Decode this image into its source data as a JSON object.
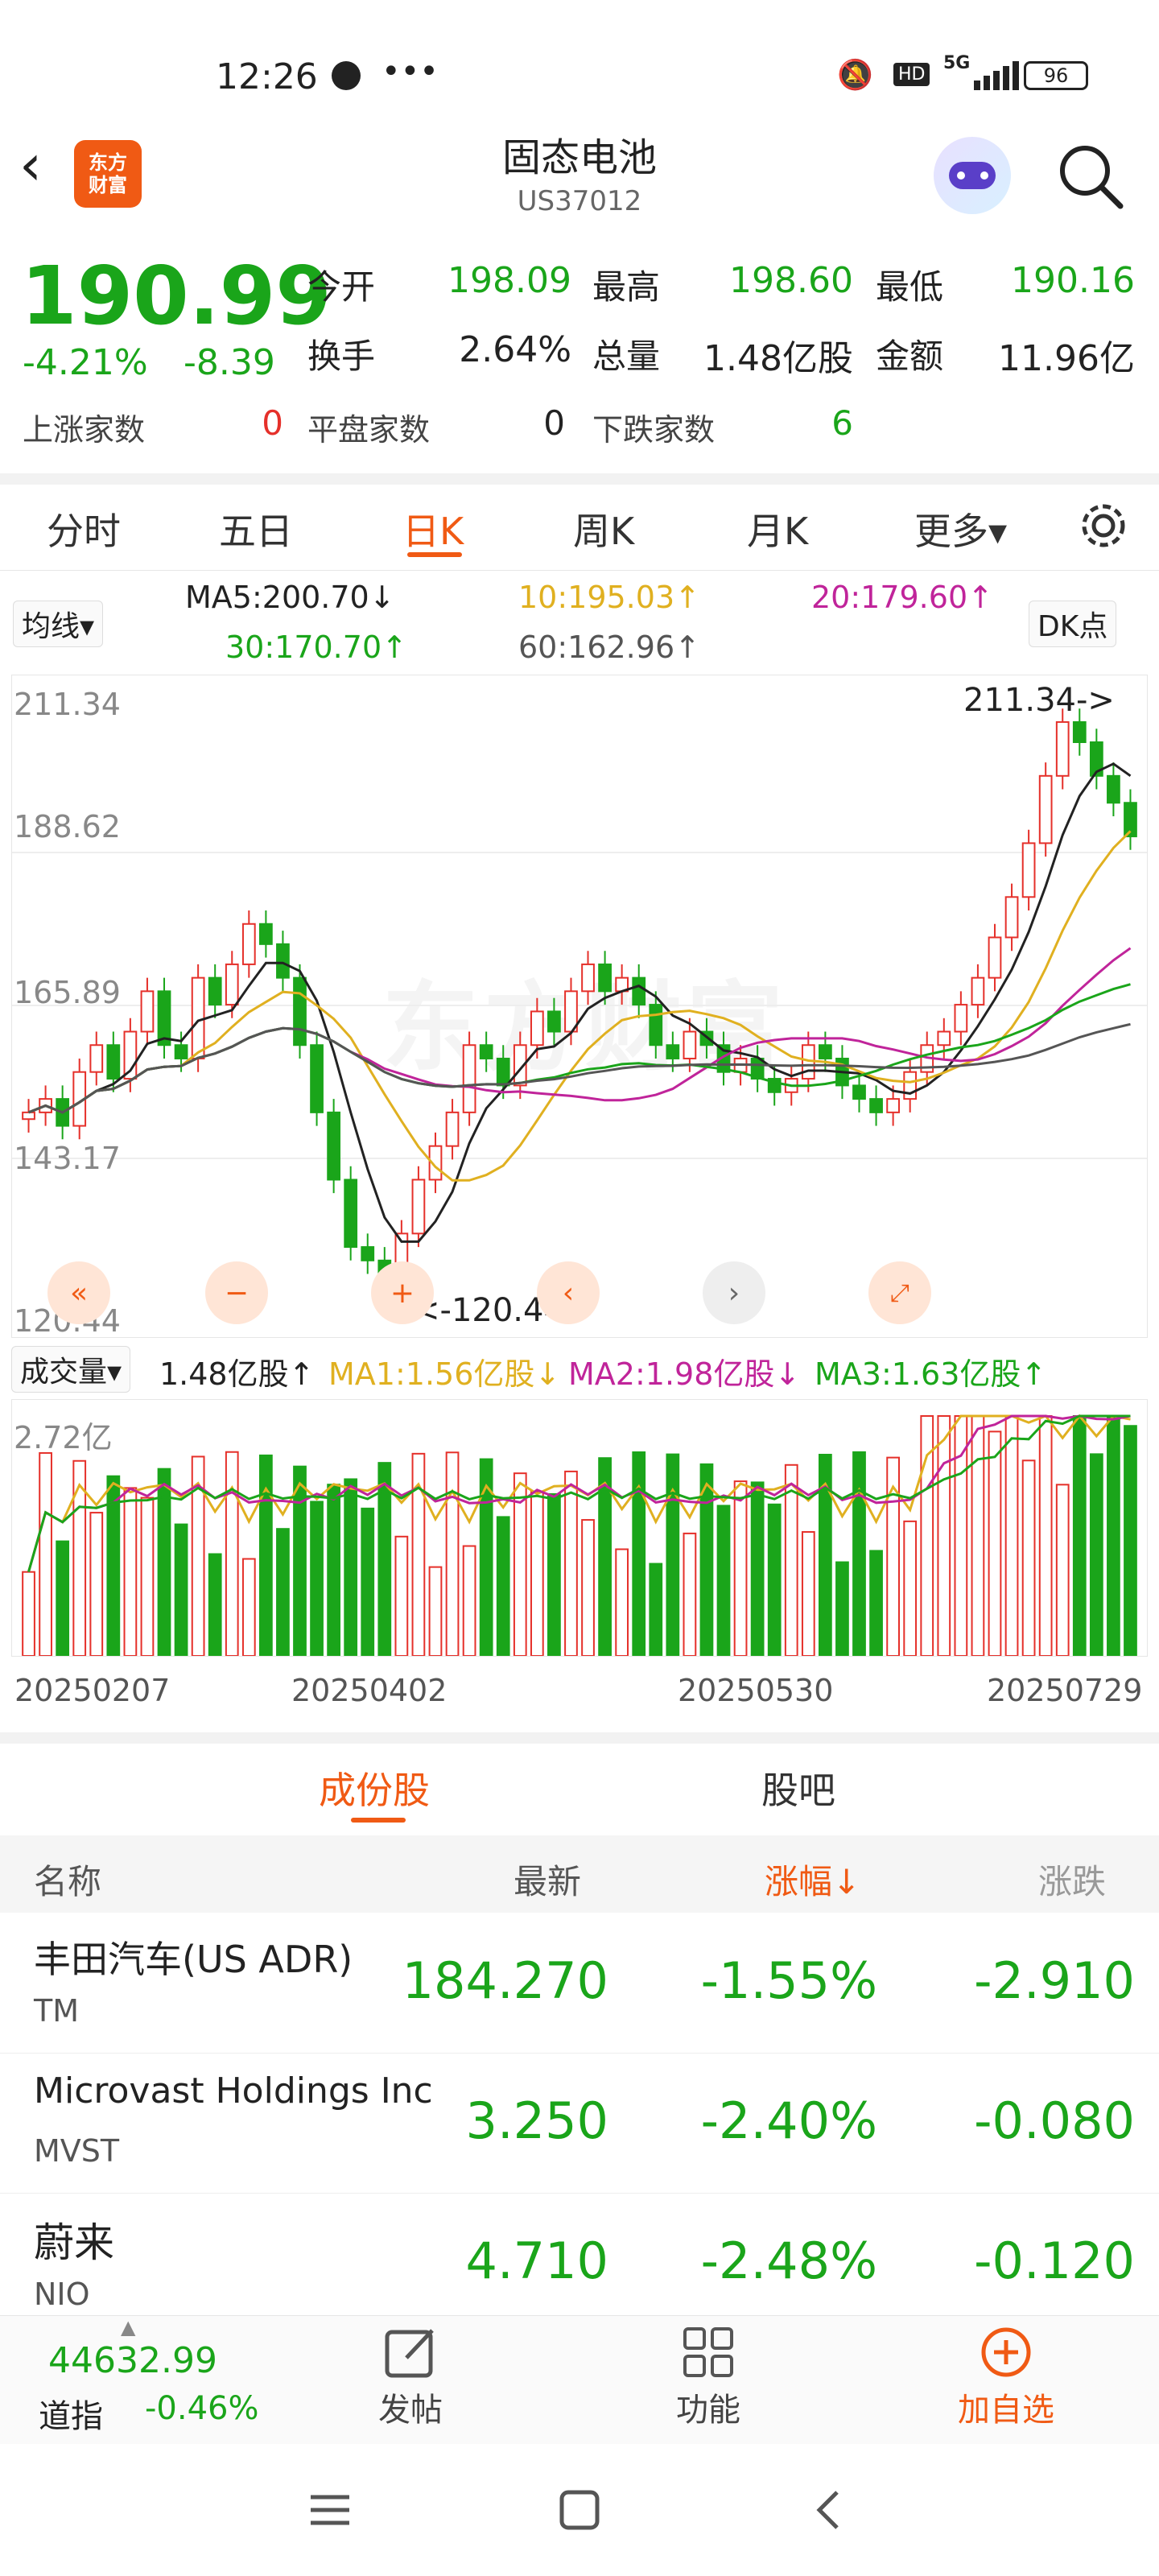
{
  "status": {
    "time": "12:26",
    "dots": "•••",
    "net": "5G",
    "battery": "96",
    "hd": "HD"
  },
  "header": {
    "title": "固态电池",
    "code": "US37012",
    "logo_text_1": "东方",
    "logo_text_2": "财富"
  },
  "quote": {
    "price": "190.99",
    "change_pct": "-4.21%",
    "change": "-8.39",
    "stats": [
      {
        "label": "今开",
        "value": "198.09"
      },
      {
        "label": "最高",
        "value": "198.60"
      },
      {
        "label": "最低",
        "value": "190.16"
      },
      {
        "label": "换手",
        "value": "2.64%"
      },
      {
        "label": "总量",
        "value": "1.48亿股"
      },
      {
        "label": "金额",
        "value": "11.96亿"
      }
    ],
    "counts": [
      {
        "label": "上涨家数",
        "value": "0"
      },
      {
        "label": "平盘家数",
        "value": "0"
      },
      {
        "label": "下跌家数",
        "value": "6"
      }
    ]
  },
  "tabs": [
    "分时",
    "五日",
    "日K",
    "周K",
    "月K",
    "更多▾"
  ],
  "ma_bar": {
    "selector": "均线▾",
    "ma5": "MA5:200.70↓",
    "ma10": "10:195.03↑",
    "ma20": "20:179.60↑",
    "ma30": "30:170.70↑",
    "ma60": "60:162.96↑",
    "dk": "DK点"
  },
  "chart_data": {
    "type": "candlestick",
    "y_labels": [
      "211.34",
      "188.62",
      "165.89",
      "143.17",
      "120.44"
    ],
    "high_marker": "211.34->",
    "low_marker": "<-120.44",
    "watermark": "东方财富",
    "ylim": [
      120.44,
      211.34
    ],
    "close_series": [
      150,
      152,
      148,
      156,
      160,
      155,
      162,
      168,
      160,
      158,
      170,
      166,
      172,
      178,
      175,
      170,
      160,
      150,
      140,
      130,
      128,
      124,
      132,
      140,
      145,
      150,
      160,
      158,
      154,
      160,
      165,
      162,
      168,
      172,
      168,
      170,
      166,
      160,
      158,
      162,
      160,
      156,
      158,
      155,
      153,
      155,
      160,
      158,
      154,
      152,
      150,
      152,
      156,
      160,
      162,
      166,
      170,
      176,
      182,
      190,
      200,
      208,
      205,
      200,
      196,
      191
    ]
  },
  "volume": {
    "selector": "成交量▾",
    "current": "1.48亿股↑",
    "ma1": "MA1:1.56亿股↓",
    "ma2": "MA2:1.98亿股↓",
    "ma3": "MA3:1.63亿股↑",
    "y_label": "2.72亿",
    "dates": [
      "20250207",
      "20250402",
      "20250530",
      "20250729"
    ]
  },
  "sub_tabs": {
    "stocks": "成份股",
    "forum": "股吧"
  },
  "table": {
    "headers": {
      "name": "名称",
      "latest": "最新",
      "pct": "涨幅↓",
      "change": "涨跌"
    },
    "rows": [
      {
        "name": "丰田汽车(US ADR)",
        "code": "TM",
        "latest": "184.270",
        "pct": "-1.55%",
        "change": "-2.910"
      },
      {
        "name": "Microvast Holdings Inc",
        "code": "MVST",
        "latest": "3.250",
        "pct": "-2.40%",
        "change": "-0.080"
      },
      {
        "name": "蔚来",
        "code": "NIO",
        "latest": "4.710",
        "pct": "-2.48%",
        "change": "-0.120"
      }
    ]
  },
  "bottom": {
    "index_value": "44632.99",
    "index_name": "道指",
    "index_pct": "-0.46%",
    "post": "发帖",
    "func": "功能",
    "add": "加自选"
  },
  "colors": {
    "up": "#e5302a",
    "down": "#1aa51a",
    "accent": "#f05a14",
    "ma5": "#222222",
    "ma10": "#e0b020",
    "ma20": "#c0249a",
    "ma30": "#1aa51a",
    "ma60": "#555555"
  }
}
